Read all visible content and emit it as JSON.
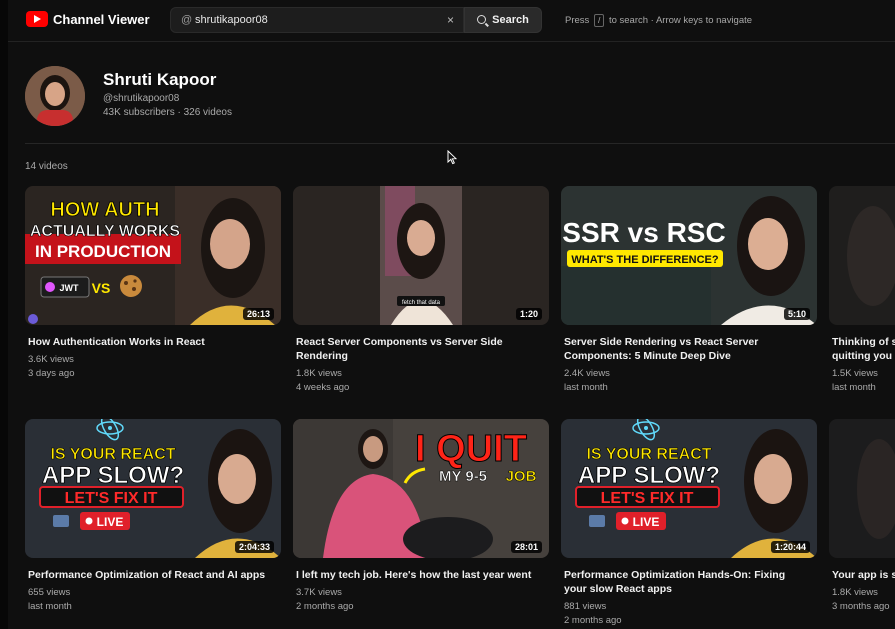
{
  "header": {
    "app_title": "Channel Viewer",
    "logo_icon": "youtube-play-icon",
    "search": {
      "prefix": "@",
      "value": "shrutikapoor08",
      "placeholder": "",
      "clear_glyph": "×"
    },
    "search_button_label": "Search",
    "hint_pre": "Press",
    "hint_key": "/",
    "hint_post": "to search · Arrow keys to navigate"
  },
  "channel": {
    "name": "Shruti Kapoor",
    "handle": "@shrutikapoor08",
    "stats": "43K subscribers · 326 videos"
  },
  "video_count_label": "14 videos",
  "videos": [
    {
      "title": "How Authentication Works in React",
      "views": "3.6K views",
      "age": "3 days ago",
      "duration": "26:13",
      "overlay": {
        "l1": "HOW AUTH",
        "l2": "ACTUALLY WORKS",
        "l3": "IN PRODUCTION",
        "jwt": "JWT",
        "vs": "VS"
      }
    },
    {
      "title": "React Server Components vs Server Side",
      "title2": "Rendering",
      "views": "1.8K views",
      "age": "4 weeks ago",
      "duration": "1:20",
      "overlay": {
        "caption": "fetch that data"
      }
    },
    {
      "title": "Server Side Rendering vs React Server",
      "title2": "Components: 5 Minute Deep Dive",
      "views": "2.4K views",
      "age": "last month",
      "duration": "5:10",
      "overlay": {
        "l1": "SSR vs RSC",
        "l2": "WHAT'S THE DIFFERENCE?"
      }
    },
    {
      "title": "Thinking of s",
      "title2": "quitting you",
      "views": "1.5K views",
      "age": "last month",
      "duration": ""
    },
    {
      "title": "Performance Optimization of React and AI apps",
      "views": "655 views",
      "age": "last month",
      "duration": "2:04:33",
      "overlay": {
        "l1": "IS YOUR REACT",
        "l2": "APP SLOW?",
        "l3": "LET'S FIX IT",
        "live": "LIVE"
      }
    },
    {
      "title": "I left my tech job. Here's how the last year went",
      "views": "3.7K views",
      "age": "2 months ago",
      "duration": "28:01",
      "overlay": {
        "l1": "I QUIT",
        "l2": "MY 9-5",
        "l3": "JOB"
      }
    },
    {
      "title": "Performance Optimization Hands-On: Fixing",
      "title2": "your slow React apps",
      "views": "881 views",
      "age": "2 months ago",
      "duration": "1:20:44",
      "overlay": {
        "l1": "IS YOUR REACT",
        "l2": "APP SLOW?",
        "l3": "LET'S FIX IT",
        "live": "LIVE"
      }
    },
    {
      "title": "Your app is s",
      "views": "1.8K views",
      "age": "3 months ago",
      "duration": ""
    }
  ]
}
